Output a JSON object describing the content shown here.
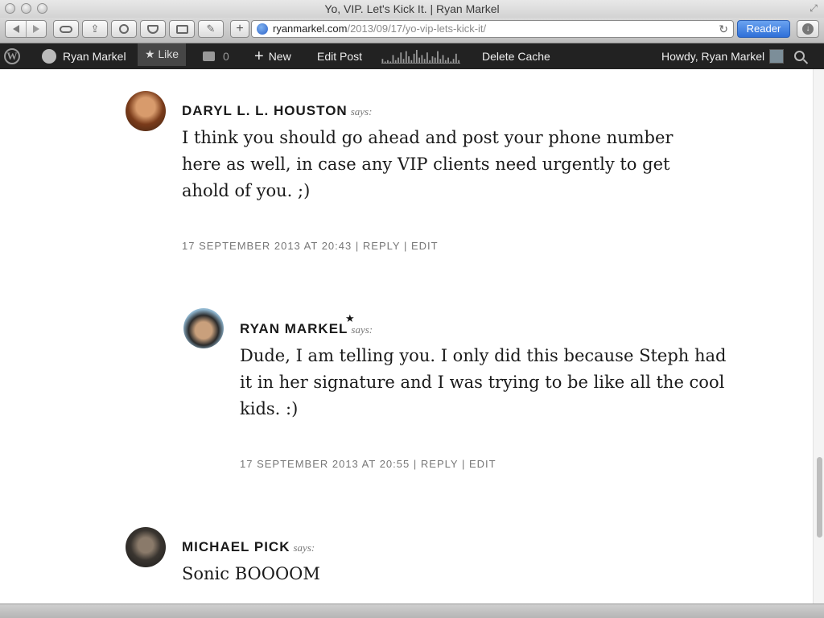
{
  "window": {
    "title": "Yo, VIP. Let's Kick It. | Ryan Markel"
  },
  "browser": {
    "url_domain": "ryanmarkel.com",
    "url_path": "/2013/09/17/yo-vip-lets-kick-it/",
    "reader_label": "Reader"
  },
  "adminbar": {
    "site_name": "Ryan Markel",
    "like_label": "★ Like",
    "comment_count": "0",
    "new_label": "New",
    "edit_post_label": "Edit Post",
    "delete_cache_label": "Delete Cache",
    "howdy_label": "Howdy, Ryan Markel",
    "sparkline_values": [
      3,
      1,
      2,
      1,
      6,
      2,
      4,
      8,
      3,
      9,
      5,
      2,
      7,
      10,
      4,
      6,
      3,
      8,
      2,
      5,
      4,
      9,
      3,
      6,
      2,
      4,
      1,
      3,
      7,
      2
    ]
  },
  "comments": [
    {
      "author": "DARYL L. L. HOUSTON",
      "says": "says:",
      "text": "I think you should go ahead and post your phone number here as well, in case any VIP clients need urgently to get ahold of you. ;)",
      "date": "17 SEPTEMBER 2013 AT 20:43",
      "reply": "REPLY",
      "edit": "EDIT"
    },
    {
      "author": "RYAN MARKEL",
      "says": "says:",
      "star": "★",
      "text": "Dude, I am telling you. I only did this because Steph had it in her signature and I was trying to be like all the cool kids. :)",
      "date": "17 SEPTEMBER 2013 AT 20:55",
      "reply": "REPLY",
      "edit": "EDIT"
    },
    {
      "author": "MICHAEL PICK",
      "says": "says:",
      "text": "Sonic BOOOOM"
    }
  ],
  "separator": "|"
}
